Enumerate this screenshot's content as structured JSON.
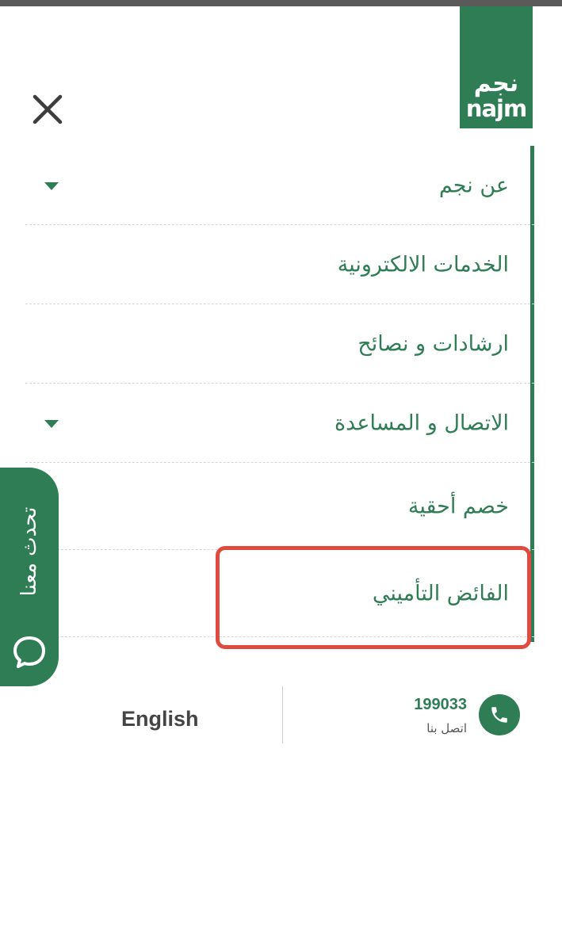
{
  "brand": {
    "logo_ar": "نجم",
    "logo_en": "najm",
    "color": "#2f7d55"
  },
  "menu": {
    "items": [
      {
        "label": "عن نجم",
        "has_dropdown": true
      },
      {
        "label": "الخدمات الالكترونية",
        "has_dropdown": false
      },
      {
        "label": "ارشادات و نصائح",
        "has_dropdown": false
      },
      {
        "label": "الاتصال و المساعدة",
        "has_dropdown": true
      },
      {
        "label": "خصم أحقية",
        "has_dropdown": false
      },
      {
        "label": "الفائض التأميني",
        "has_dropdown": false,
        "highlighted": true
      }
    ]
  },
  "chat": {
    "label": "تحدث معنا",
    "icon": "chat-bubble-icon"
  },
  "footer": {
    "phone_number": "199033",
    "phone_caption": "اتصل بنا",
    "language_label": "English",
    "phone_icon": "phone-icon"
  },
  "highlight_color": "#e14b3f"
}
